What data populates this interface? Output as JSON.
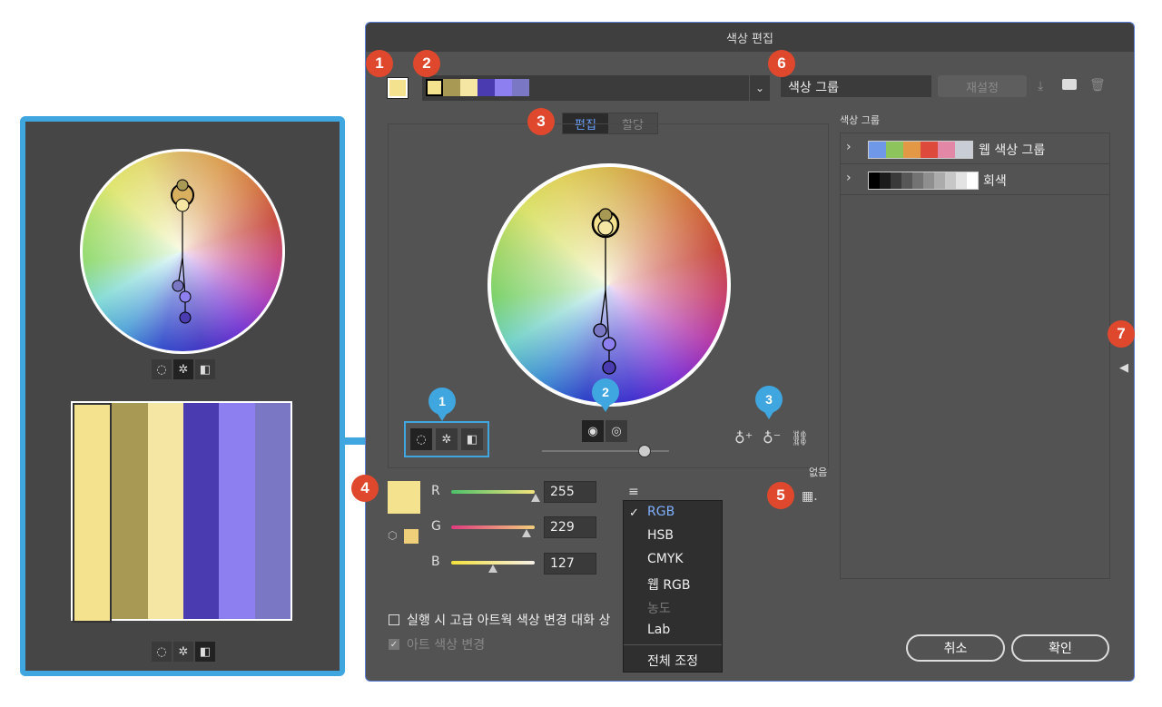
{
  "dialog": {
    "title": "색상 편집",
    "group_name": "색상 그룹",
    "reset_label": "재설정",
    "tabs": {
      "edit": "편집",
      "assign": "할당"
    },
    "none_label": "없음",
    "group_list_title": "색상 그룹",
    "groups": [
      {
        "name": "웹 색상 그룹",
        "colors": [
          "#6f98e8",
          "#8ec45c",
          "#e39845",
          "#dd4a3b",
          "#e287a6",
          "#c9cdd6"
        ]
      },
      {
        "name": "회색",
        "colors": [
          "#000000",
          "#1c1c1c",
          "#3a3a3a",
          "#575757",
          "#737373",
          "#8f8f8f",
          "#ababab",
          "#c7c7c7",
          "#e3e3e3",
          "#ffffff"
        ]
      }
    ],
    "harmony_swatches": [
      "#f5e28f",
      "#a89a55",
      "#f5e7a3",
      "#4a3bb0",
      "#8e7ff0",
      "#7a77c4"
    ],
    "current_color": "#f5e28f",
    "rgb": {
      "r_label": "R",
      "r_value": "255",
      "g_label": "G",
      "g_value": "229",
      "b_label": "B",
      "b_value": "127"
    },
    "mode_menu": {
      "items": [
        "RGB",
        "HSB",
        "CMYK",
        "웹 RGB",
        "농도",
        "Lab",
        "전체 조정"
      ],
      "selected": "RGB",
      "disabled": [
        "농도"
      ]
    },
    "checkbox1_label": "실행 시 고급 아트웍 색상 변경 대화 상",
    "checkbox2_label": "아트 색상 변경",
    "cancel_label": "취소",
    "ok_label": "확인"
  },
  "callouts": {
    "c1": "1",
    "c2": "2",
    "c3": "3",
    "c4": "4",
    "c5": "5",
    "c6": "6",
    "c7": "7",
    "b1": "1",
    "b2": "2",
    "b3": "3"
  },
  "left_panel": {
    "swatches": [
      "#f5e28f",
      "#a89a55",
      "#f5e7a3",
      "#4a3bb0",
      "#8e7ff0",
      "#7a77c4"
    ]
  },
  "icons": [
    "smooth-wheel-icon",
    "segmented-wheel-icon",
    "color-bars-icon",
    "brightness-icon",
    "saturation-icon",
    "add-color-icon",
    "remove-color-icon",
    "link-icon",
    "grid-icon",
    "menu-icon",
    "save-icon",
    "folder-icon",
    "trash-icon",
    "collapse-arrow-icon"
  ]
}
